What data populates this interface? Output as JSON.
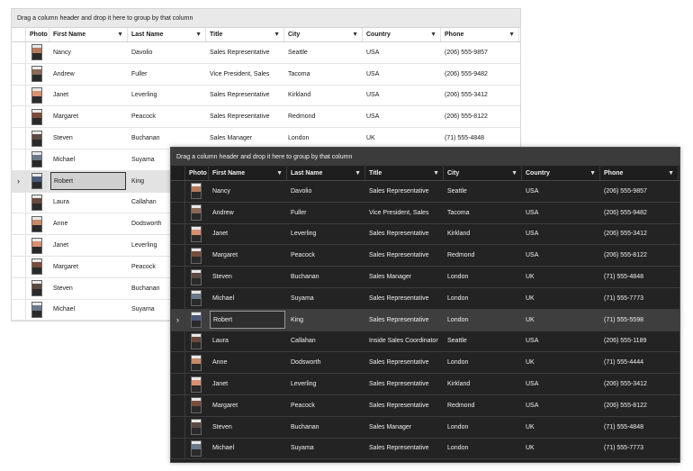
{
  "light_grid": {
    "group_panel_text": "Drag a column header and drop it here to group by that column",
    "columns": [
      {
        "label": "Photo",
        "filter": false
      },
      {
        "label": "First Name",
        "filter": true
      },
      {
        "label": "Last Name",
        "filter": true
      },
      {
        "label": "Title",
        "filter": true
      },
      {
        "label": "City",
        "filter": true
      },
      {
        "label": "Country",
        "filter": true
      },
      {
        "label": "Phone",
        "filter": true
      }
    ],
    "selected_index": 6,
    "rows": [
      {
        "first": "Nancy",
        "last": "Davolio",
        "title": "Sales Representative",
        "city": "Seattle",
        "country": "USA",
        "phone": "(206) 555-9857",
        "photo_color": "#b77a5c"
      },
      {
        "first": "Andrew",
        "last": "Fuller",
        "title": "Vice President, Sales",
        "city": "Tacoma",
        "country": "USA",
        "phone": "(206) 555-9482",
        "photo_color": "#8a6a56"
      },
      {
        "first": "Janet",
        "last": "Leverling",
        "title": "Sales Representative",
        "city": "Kirkland",
        "country": "USA",
        "phone": "(206) 555-3412",
        "photo_color": "#d89070"
      },
      {
        "first": "Margaret",
        "last": "Peacock",
        "title": "Sales Representative",
        "city": "Redmond",
        "country": "USA",
        "phone": "(206) 555-8122",
        "photo_color": "#7a4c3c"
      },
      {
        "first": "Steven",
        "last": "Buchanan",
        "title": "Sales Manager",
        "city": "London",
        "country": "UK",
        "phone": "(71) 555-4848",
        "photo_color": "#5c4a42"
      },
      {
        "first": "Michael",
        "last": "Suyama",
        "title": "",
        "city": "",
        "country": "",
        "phone": "",
        "photo_color": "#6a7a8a"
      },
      {
        "first": "Robert",
        "last": "King",
        "title": "",
        "city": "",
        "country": "",
        "phone": "",
        "photo_color": "#4a5a7a"
      },
      {
        "first": "Laura",
        "last": "Callahan",
        "title": "",
        "city": "",
        "country": "",
        "phone": "",
        "photo_color": "#6a4a3a"
      },
      {
        "first": "Anne",
        "last": "Dodsworth",
        "title": "",
        "city": "",
        "country": "",
        "phone": "",
        "photo_color": "#c88a68"
      },
      {
        "first": "Janet",
        "last": "Leverling",
        "title": "",
        "city": "",
        "country": "",
        "phone": "",
        "photo_color": "#d89070"
      },
      {
        "first": "Margaret",
        "last": "Peacock",
        "title": "",
        "city": "",
        "country": "",
        "phone": "",
        "photo_color": "#7a4c3c"
      },
      {
        "first": "Steven",
        "last": "Buchanan",
        "title": "",
        "city": "",
        "country": "",
        "phone": "",
        "photo_color": "#5c4a42"
      },
      {
        "first": "Michael",
        "last": "Suyama",
        "title": "",
        "city": "",
        "country": "",
        "phone": "",
        "photo_color": "#6a7a8a"
      }
    ]
  },
  "dark_grid": {
    "group_panel_text": "Drag a column header and drop it here to group by that column",
    "columns": [
      {
        "label": "Photo",
        "filter": false
      },
      {
        "label": "First Name",
        "filter": true
      },
      {
        "label": "Last Name",
        "filter": true
      },
      {
        "label": "Title",
        "filter": true
      },
      {
        "label": "City",
        "filter": true
      },
      {
        "label": "Country",
        "filter": true
      },
      {
        "label": "Phone",
        "filter": true
      }
    ],
    "selected_index": 6,
    "rows": [
      {
        "first": "Nancy",
        "last": "Davolio",
        "title": "Sales Representative",
        "city": "Seattle",
        "country": "USA",
        "phone": "(206) 555-9857",
        "photo_color": "#b77a5c"
      },
      {
        "first": "Andrew",
        "last": "Fuller",
        "title": "Vice President, Sales",
        "city": "Tacoma",
        "country": "USA",
        "phone": "(206) 555-9482",
        "photo_color": "#8a6a56"
      },
      {
        "first": "Janet",
        "last": "Leverling",
        "title": "Sales Representative",
        "city": "Kirkland",
        "country": "USA",
        "phone": "(206) 555-3412",
        "photo_color": "#d89070"
      },
      {
        "first": "Margaret",
        "last": "Peacock",
        "title": "Sales Representative",
        "city": "Redmond",
        "country": "USA",
        "phone": "(206) 555-8122",
        "photo_color": "#7a4c3c"
      },
      {
        "first": "Steven",
        "last": "Buchanan",
        "title": "Sales Manager",
        "city": "London",
        "country": "UK",
        "phone": "(71) 555-4848",
        "photo_color": "#5c4a42"
      },
      {
        "first": "Michael",
        "last": "Suyama",
        "title": "Sales Representative",
        "city": "London",
        "country": "UK",
        "phone": "(71) 555-7773",
        "photo_color": "#6a7a8a"
      },
      {
        "first": "Robert",
        "last": "King",
        "title": "Sales Representative",
        "city": "London",
        "country": "UK",
        "phone": "(71) 555-5598",
        "photo_color": "#4a5a7a"
      },
      {
        "first": "Laura",
        "last": "Callahan",
        "title": "Inside Sales Coordinator",
        "city": "Seattle",
        "country": "USA",
        "phone": "(206) 555-1189",
        "photo_color": "#6a4a3a"
      },
      {
        "first": "Anne",
        "last": "Dodsworth",
        "title": "Sales Representative",
        "city": "London",
        "country": "UK",
        "phone": "(71) 555-4444",
        "photo_color": "#c88a68"
      },
      {
        "first": "Janet",
        "last": "Leverling",
        "title": "Sales Representative",
        "city": "Kirkland",
        "country": "USA",
        "phone": "(206) 555-3412",
        "photo_color": "#d89070"
      },
      {
        "first": "Margaret",
        "last": "Peacock",
        "title": "Sales Representative",
        "city": "Redmond",
        "country": "USA",
        "phone": "(206) 555-8122",
        "photo_color": "#7a4c3c"
      },
      {
        "first": "Steven",
        "last": "Buchanan",
        "title": "Sales Manager",
        "city": "London",
        "country": "UK",
        "phone": "(71) 555-4848",
        "photo_color": "#5c4a42"
      },
      {
        "first": "Michael",
        "last": "Suyama",
        "title": "Sales Representative",
        "city": "London",
        "country": "UK",
        "phone": "(71) 555-7773",
        "photo_color": "#6a7a8a"
      }
    ]
  },
  "icons": {
    "filter": "filter-funnel-icon",
    "current_row": "chevron-right-icon",
    "filter_glyph": "▼",
    "current_row_glyph": "›"
  }
}
